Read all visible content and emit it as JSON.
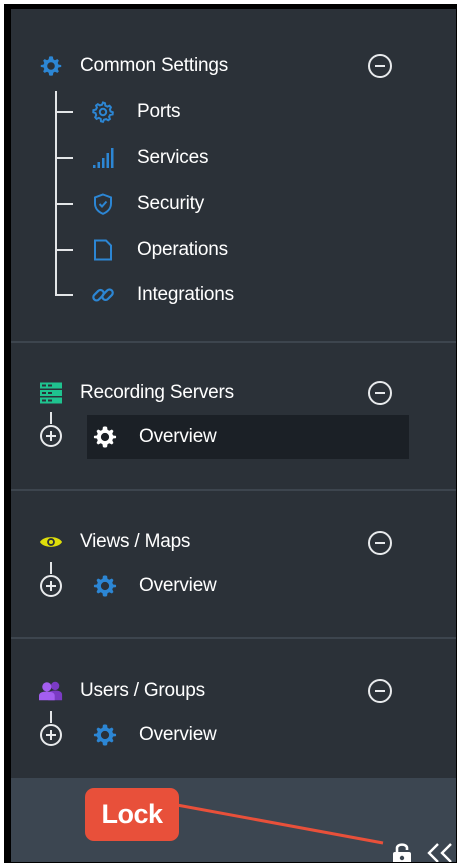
{
  "colors": {
    "panel_bg": "#2b3138",
    "footer_bg": "#3c4651",
    "selected_row_bg": "#1b2026",
    "accent_blue": "#2c86d4",
    "recording_green": "#1fc38f",
    "views_yellow": "#dede0a",
    "users_purple": "#9e4de8",
    "callout_red": "#e8503a"
  },
  "common_settings": {
    "title": "Common Settings",
    "icon": "gear-icon",
    "items": [
      {
        "label": "Ports",
        "icon": "ports-gear-icon"
      },
      {
        "label": "Services",
        "icon": "signal-bars-icon"
      },
      {
        "label": "Security",
        "icon": "shield-icon"
      },
      {
        "label": "Operations",
        "icon": "document-icon"
      },
      {
        "label": "Integrations",
        "icon": "link-icon"
      }
    ]
  },
  "recording_servers": {
    "title": "Recording Servers",
    "icon": "server-icon",
    "overview_label": "Overview",
    "overview_icon": "gear-icon",
    "selected": true
  },
  "views_maps": {
    "title": "Views / Maps",
    "icon": "eye-icon",
    "overview_label": "Overview",
    "overview_icon": "gear-icon"
  },
  "users_groups": {
    "title": "Users / Groups",
    "icon": "users-icon",
    "overview_label": "Overview",
    "overview_icon": "gear-icon"
  },
  "footer": {
    "callout_label": "Lock",
    "lock_icon": "lock-icon",
    "collapse_icon": "double-chevron-left-icon"
  }
}
